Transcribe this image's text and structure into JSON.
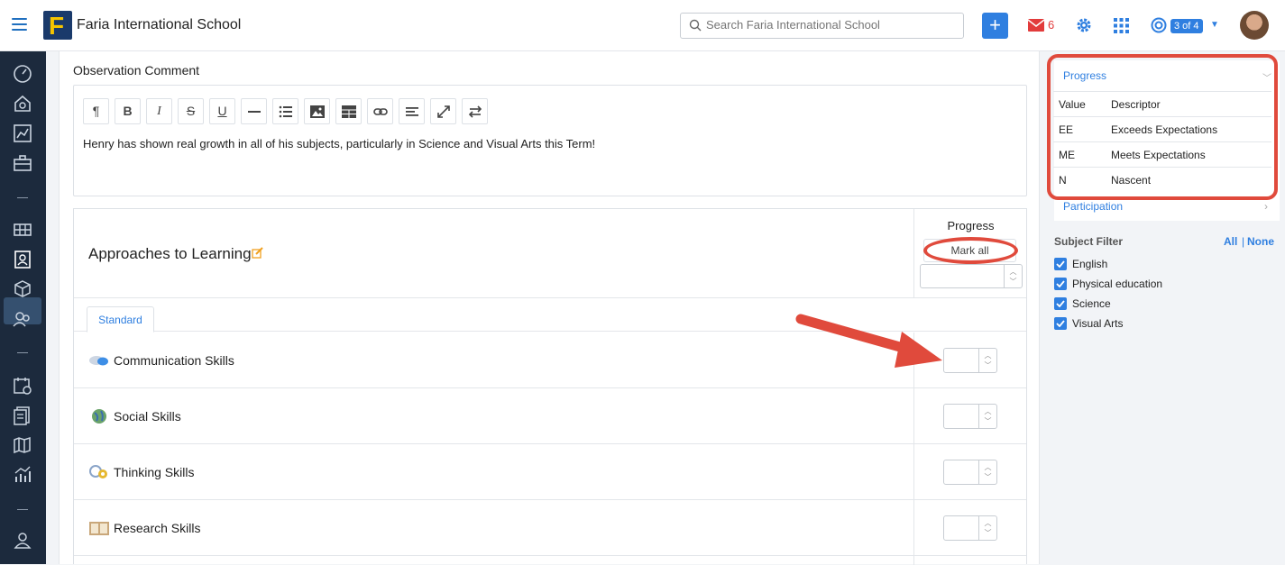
{
  "topbar": {
    "school_name": "Faria International School",
    "search_placeholder": "Search Faria International School",
    "logo_letter": "F",
    "mail_count": "6",
    "page_badge": "3 of 4",
    "plus_label": "+"
  },
  "editor": {
    "label": "Observation Comment",
    "toolbar": [
      "paragraph-icon",
      "bold-icon",
      "italic-icon",
      "strikethrough-icon",
      "underline-icon",
      "horizontal-rule-icon",
      "list-icon",
      "image-icon",
      "table-icon",
      "link-icon",
      "align-icon",
      "fullscreen-icon",
      "swap-icon"
    ],
    "toolbar_glyphs": {
      "paragraph": "¶",
      "bold": "B",
      "italic": "I",
      "strike": "S",
      "underline": "U"
    },
    "text": "Henry has shown real growth in all of his subjects, particularly in Science and Visual Arts this Term!"
  },
  "atl": {
    "title": "Approaches to Learning",
    "progress_header": "Progress",
    "mark_all": "Mark all",
    "tab": "Standard",
    "skills": [
      {
        "label": "Communication Skills",
        "icon": "communication-icon"
      },
      {
        "label": "Social Skills",
        "icon": "globe-icon"
      },
      {
        "label": "Thinking Skills",
        "icon": "gears-icon"
      },
      {
        "label": "Research Skills",
        "icon": "book-icon"
      }
    ]
  },
  "right_panel": {
    "progress_title": "Progress",
    "table_headers": [
      "Value",
      "Descriptor"
    ],
    "table_rows": [
      [
        "EE",
        "Exceeds Expectations"
      ],
      [
        "ME",
        "Meets Expectations"
      ],
      [
        "N",
        "Nascent"
      ]
    ],
    "participation": "Participation",
    "subject_filter": {
      "title": "Subject Filter",
      "all": "All",
      "separator": "|",
      "none": "None",
      "subjects": [
        "English",
        "Physical education",
        "Science",
        "Visual Arts"
      ]
    }
  },
  "colors": {
    "accent": "#2f7fe0",
    "annotation": "#e04a3c",
    "sidebar": "#1c2a3d"
  }
}
